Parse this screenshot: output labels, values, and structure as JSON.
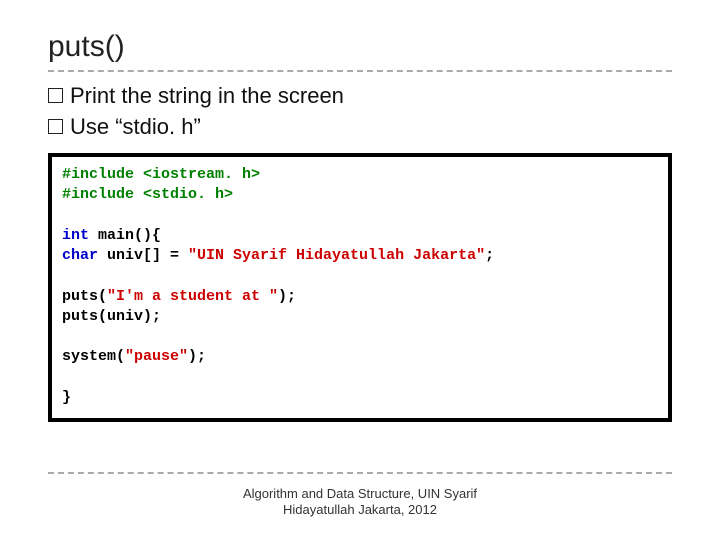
{
  "title": "puts()",
  "bullets": [
    {
      "text": "Print the string in the screen"
    },
    {
      "text": "Use “stdio. h”"
    }
  ],
  "code": {
    "l1a": "#include ",
    "l1b": "<iostream. h>",
    "l2a": "#include ",
    "l2b": "<stdio. h>",
    "l3a": "int",
    "l3b": " main(){",
    "l4a": "    ",
    "l4b": "char",
    "l4c": " univ[] = ",
    "l4d": "\"UIN Syarif Hidayatullah Jakarta\"",
    "l4e": ";",
    "l5a": "    puts(",
    "l5b": "\"I'm a student at \"",
    "l5c": ");",
    "l6a": "    puts(univ);",
    "l7a": "    system(",
    "l7b": "\"pause\"",
    "l7c": ");",
    "l8a": "}"
  },
  "footer": {
    "line1": "Algorithm and Data Structure, UIN Syarif",
    "line2": "Hidayatullah Jakarta, 2012"
  }
}
